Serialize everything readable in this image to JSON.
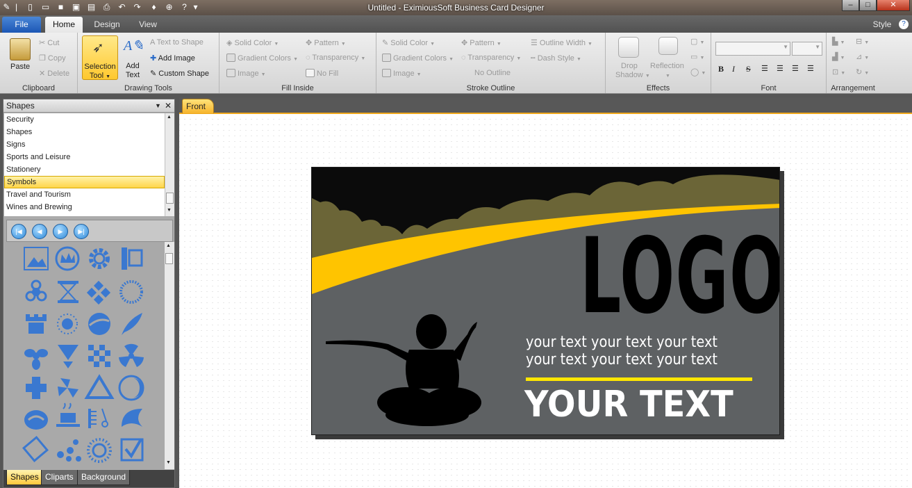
{
  "window": {
    "title": "Untitled - EximiousSoft Business Card Designer"
  },
  "menu": {
    "tabs": [
      "File",
      "Home",
      "Design",
      "View"
    ],
    "style_label": "Style"
  },
  "ribbon": {
    "clipboard": {
      "label": "Clipboard",
      "paste": "Paste",
      "cut": "Cut",
      "copy": "Copy",
      "delete": "Delete"
    },
    "drawing": {
      "label": "Drawing Tools",
      "selection_line1": "Selection",
      "selection_line2": "Tool",
      "add_line1": "Add",
      "add_line2": "Text",
      "text_to_shape": "Text to Shape",
      "add_image": "Add Image",
      "custom_shape": "Custom Shape"
    },
    "fill": {
      "label": "Fill Inside",
      "solid_color": "Solid Color",
      "gradient_colors": "Gradient Colors",
      "image": "Image",
      "pattern": "Pattern",
      "transparency": "Transparency",
      "no_fill": "No Fill"
    },
    "stroke": {
      "label": "Stroke Outline",
      "solid_color": "Solid Color",
      "gradient_colors": "Gradient Colors",
      "image": "Image",
      "pattern": "Pattern",
      "transparency": "Transparency",
      "no_outline": "No Outline",
      "outline_width": "Outline Width",
      "dash_style": "Dash Style"
    },
    "effects": {
      "label": "Effects",
      "drop_line1": "Drop",
      "drop_line2": "Shadow",
      "reflection": "Reflection"
    },
    "font": {
      "label": "Font",
      "bold": "B",
      "italic": "I",
      "strike": "S"
    },
    "arrangement": {
      "label": "Arrangement"
    }
  },
  "shapes_panel": {
    "title": "Shapes",
    "categories": [
      "Security",
      "Shapes",
      "Signs",
      "Sports and Leisure",
      "Stationery",
      "Symbols",
      "Travel and Tourism",
      "Wines and Brewing"
    ],
    "selected": "Symbols",
    "tabs": [
      "Shapes",
      "Cliparts",
      "Background"
    ]
  },
  "doc": {
    "tab": "Front"
  },
  "card": {
    "logo": "LOGO",
    "line1": "your text  your text  your text",
    "line2": "your text  your text  your text",
    "big": "YOUR TEXT"
  },
  "colors": {
    "accent": "#ffc400",
    "card_bg": "#5e6163",
    "olive": "#6b6537",
    "shape_blue": "#3a78d0"
  }
}
